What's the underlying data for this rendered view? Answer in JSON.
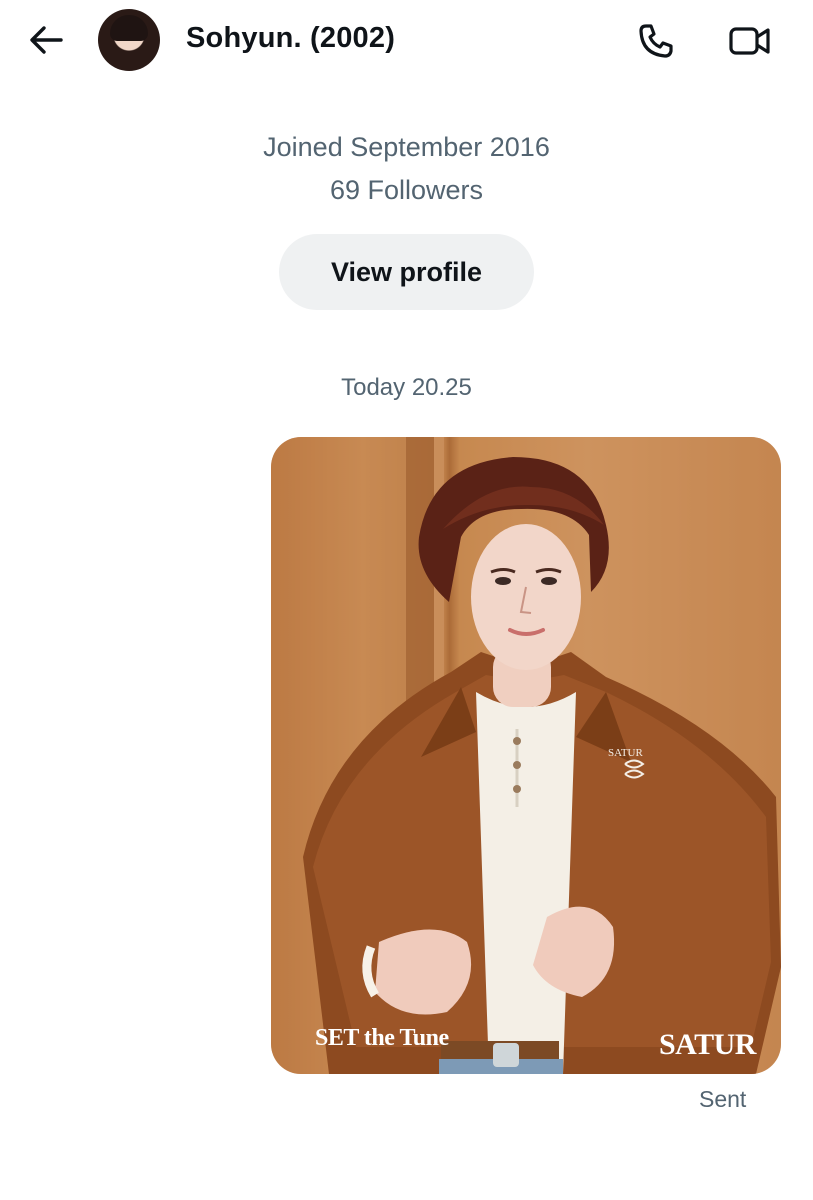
{
  "header": {
    "contact_name": "Sohyun. (2002)",
    "icons": {
      "back": "back-arrow-icon",
      "call": "phone-icon",
      "video": "video-camera-icon"
    }
  },
  "profile_info": {
    "joined": "Joined September 2016",
    "followers": "69 Followers",
    "view_profile_label": "View profile"
  },
  "conversation": {
    "timestamp": "Today 20.25",
    "message": {
      "type": "image",
      "overlay_texts": {
        "left_logo": "SET the Tune",
        "right_logo": "SATUR",
        "jacket_brand": "SATUR"
      },
      "status": "Sent"
    }
  },
  "colors": {
    "text_primary": "#0f1419",
    "text_secondary": "#536471",
    "button_bg": "#eff1f2",
    "image_tone": "#c48450"
  }
}
